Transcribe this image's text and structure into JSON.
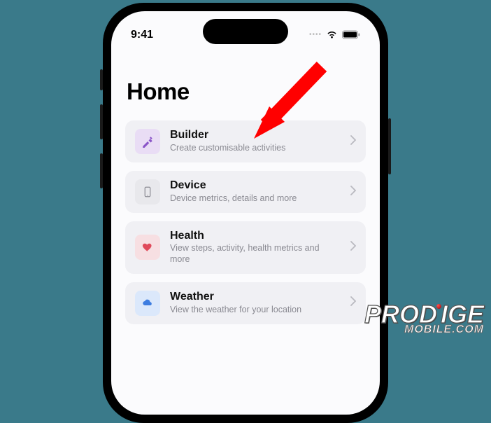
{
  "status": {
    "time": "9:41"
  },
  "page": {
    "title": "Home"
  },
  "rows": [
    {
      "title": "Builder",
      "sub": "Create customisable activities"
    },
    {
      "title": "Device",
      "sub": "Device metrics, details and more"
    },
    {
      "title": "Health",
      "sub": "View steps, activity, health metrics and more"
    },
    {
      "title": "Weather",
      "sub": "View the weather for your location"
    }
  ],
  "watermark": {
    "line1": "PRODIGE",
    "line2": "MOBILE.COM"
  }
}
